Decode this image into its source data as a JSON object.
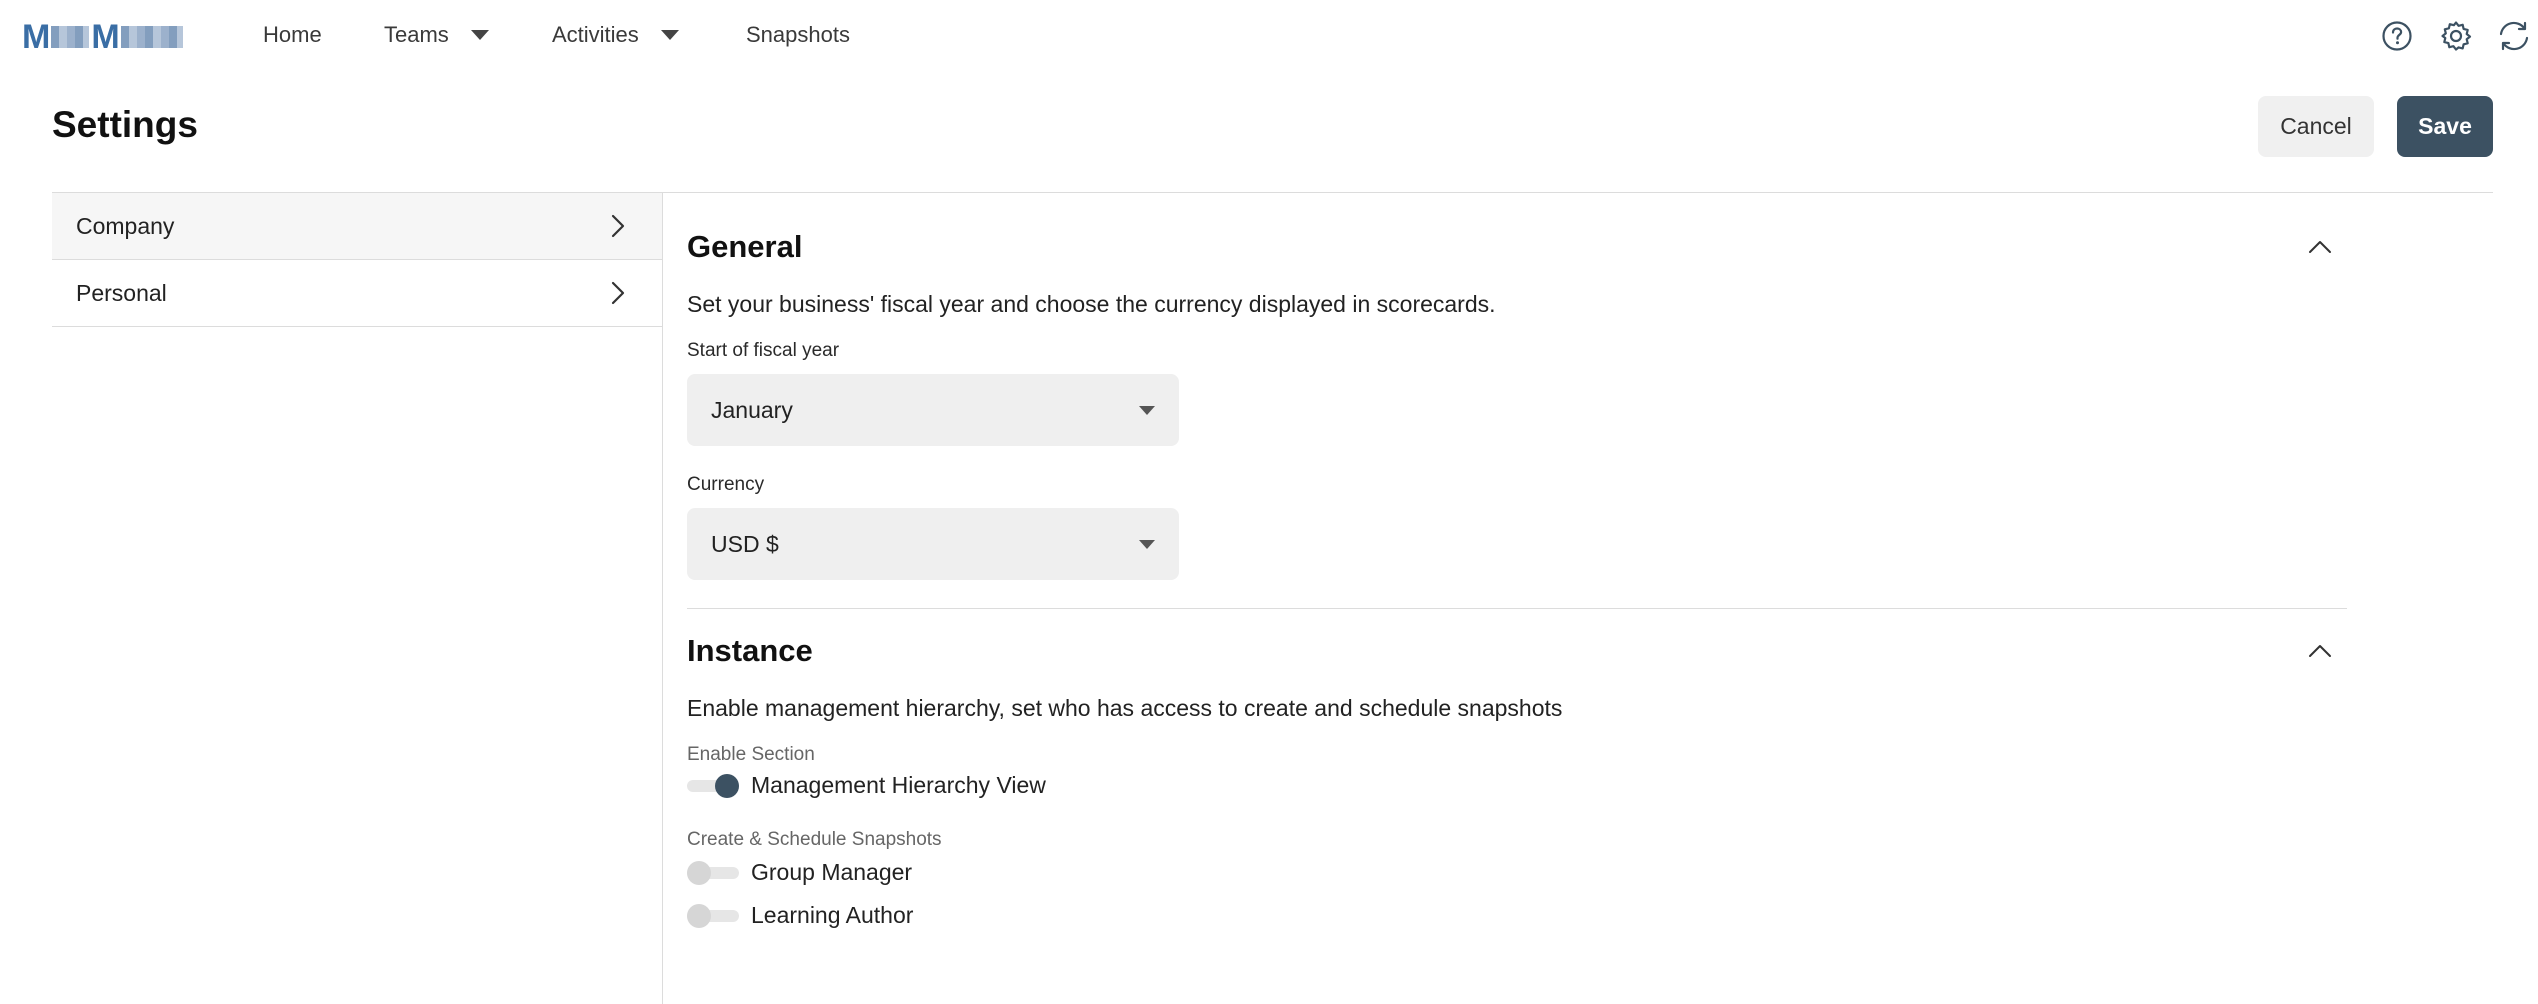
{
  "nav": {
    "logo_alt": "MM",
    "items": [
      {
        "label": "Home",
        "dropdown": false
      },
      {
        "label": "Teams",
        "dropdown": true
      },
      {
        "label": "Activities",
        "dropdown": true
      },
      {
        "label": "Snapshots",
        "dropdown": false
      }
    ],
    "icons": [
      "help-icon",
      "gear-icon",
      "refresh-icon"
    ]
  },
  "header": {
    "title": "Settings",
    "cancel_label": "Cancel",
    "save_label": "Save"
  },
  "sidebar": {
    "items": [
      {
        "label": "Company"
      },
      {
        "label": "Personal"
      }
    ]
  },
  "general": {
    "title": "General",
    "description": "Set your business' fiscal year and choose the currency displayed in scorecards.",
    "fiscal_label": "Start of fiscal year",
    "fiscal_value": "January",
    "currency_label": "Currency",
    "currency_value": "USD $"
  },
  "instance": {
    "title": "Instance",
    "description": "Enable management hierarchy, set who has access to create and schedule snapshots",
    "enable_section_label": "Enable Section",
    "hierarchy_toggle": {
      "label": "Management Hierarchy View",
      "on": true
    },
    "snapshots_label": "Create & Schedule Snapshots",
    "group_manager_toggle": {
      "label": "Group Manager",
      "on": false
    },
    "learning_author_toggle": {
      "label": "Learning Author",
      "on": false
    }
  },
  "colors": {
    "primary": "#3c5162",
    "cancel_bg": "#f0f0f0",
    "select_bg": "#efefef",
    "divider": "#dcdcdc"
  }
}
